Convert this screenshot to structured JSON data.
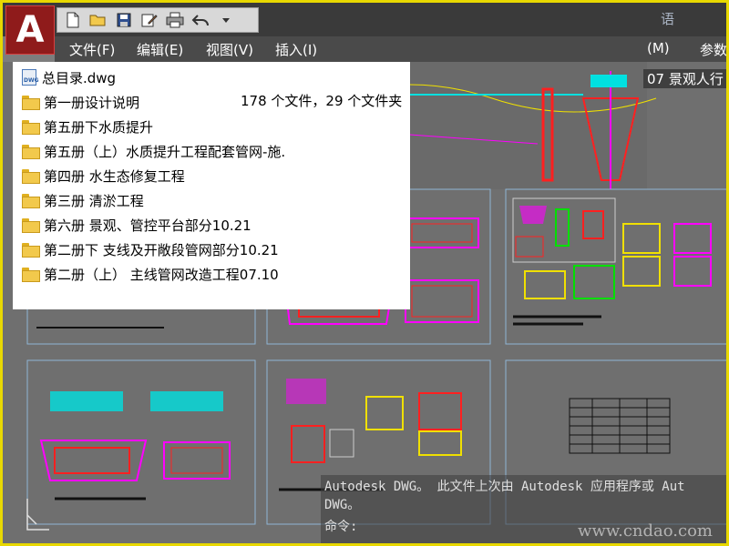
{
  "app": {
    "logo": "A",
    "title_fragment": "语",
    "quick_access": [
      "new-icon",
      "open-icon",
      "save-icon",
      "saveas-icon",
      "print-icon",
      "undo-icon",
      "dropdown-icon"
    ]
  },
  "menu": {
    "items": [
      {
        "label": "文件(F)"
      },
      {
        "label": "编辑(E)"
      },
      {
        "label": "视图(V)"
      },
      {
        "label": "插入(I)"
      },
      {
        "label": "(M)"
      },
      {
        "label": "参数"
      }
    ]
  },
  "drawing": {
    "tab_title": "07 景观人行"
  },
  "file_list": {
    "summary": "178 个文件，29 个文件夹",
    "items": [
      {
        "label": "总目录.dwg",
        "icon": "dwg-file-icon"
      },
      {
        "label": "第一册设计说明",
        "icon": "folder-icon"
      },
      {
        "label": "第五册下水质提升",
        "icon": "folder-icon"
      },
      {
        "label": "第五册（上）水质提升工程配套管网-施.",
        "icon": "folder-icon"
      },
      {
        "label": "第四册  水生态修复工程",
        "icon": "folder-icon"
      },
      {
        "label": "第三册 清淤工程",
        "icon": "folder-icon"
      },
      {
        "label": "第六册 景观、管控平台部分10.21",
        "icon": "folder-icon"
      },
      {
        "label": "第二册下 支线及开敞段管网部分10.21",
        "icon": "folder-icon"
      },
      {
        "label": "第二册（上） 主线管网改造工程07.10",
        "icon": "folder-icon"
      }
    ]
  },
  "command": {
    "history_1": "Autodesk DWG。  此文件上次由 Autodesk 应用程序或 Aut",
    "history_2": "DWG。",
    "prompt": "命令:",
    "watermark": "www.cndao.com"
  },
  "colors": {
    "frame": "#e8d800",
    "cad_magenta": "#ff00ff",
    "cad_red": "#ff2020",
    "cad_green": "#00e000",
    "cad_yellow": "#f0e000",
    "cad_cyan": "#00e0e0"
  }
}
